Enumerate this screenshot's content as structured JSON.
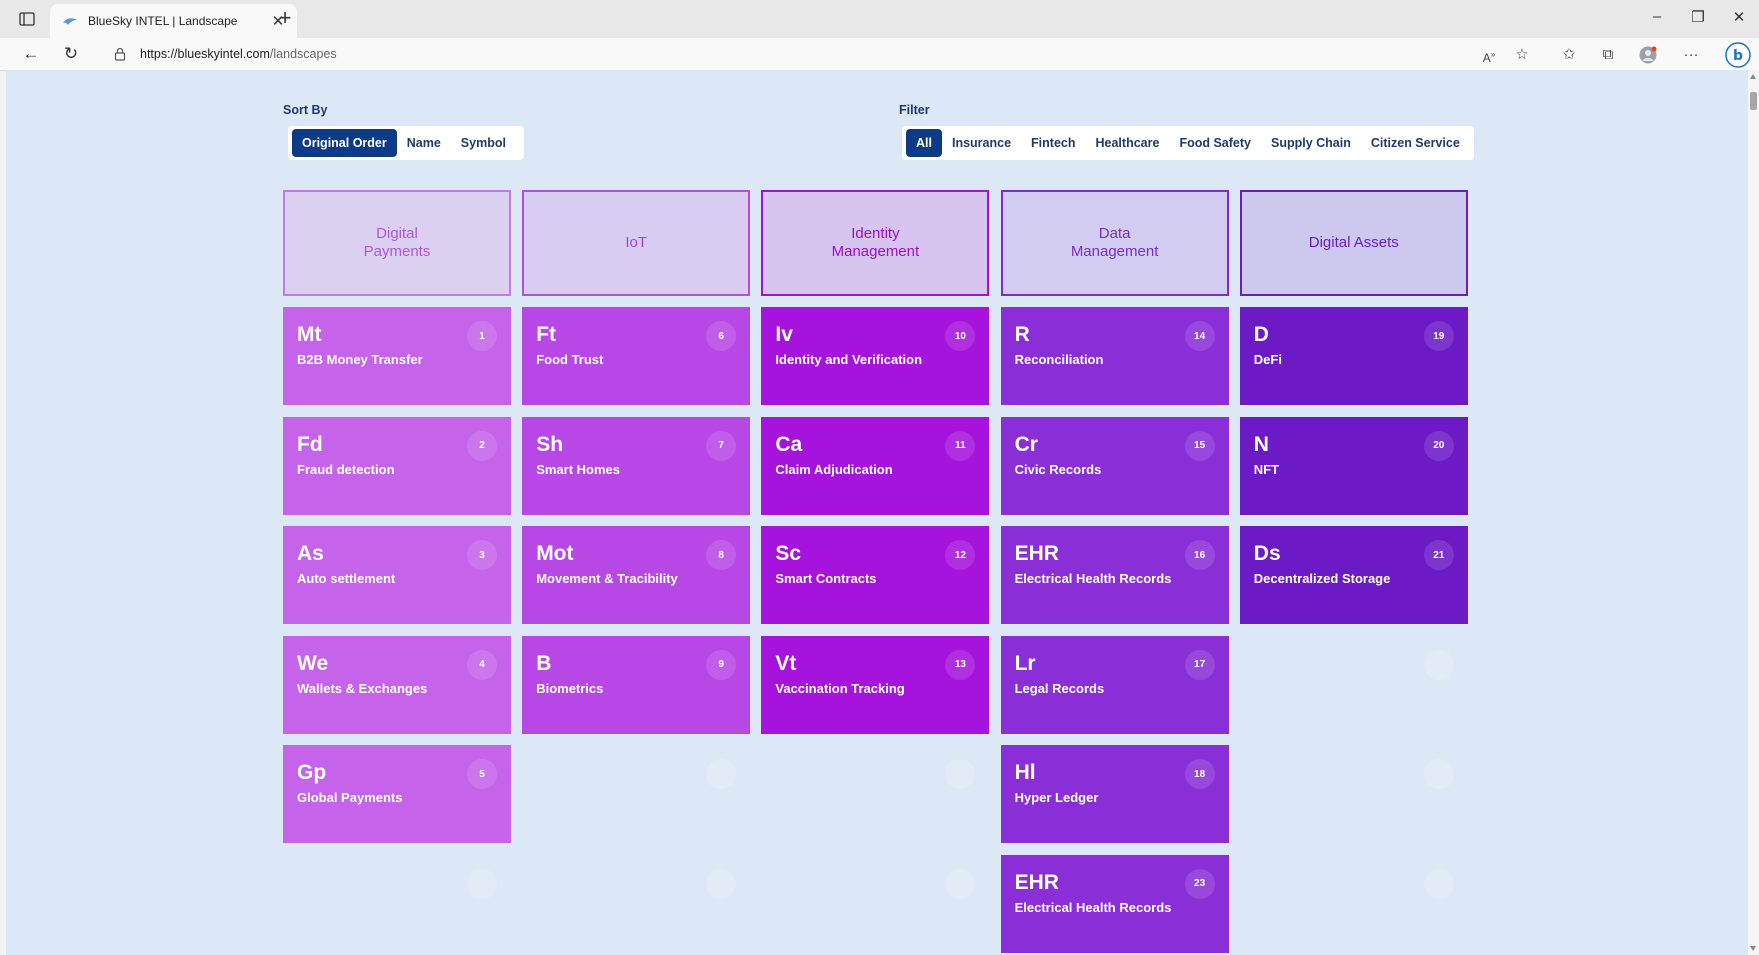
{
  "browser": {
    "tab_title": "BlueSky INTEL | Landscape",
    "url_host": "https://blueskyintel.com",
    "url_path": "/landscapes"
  },
  "sort": {
    "label": "Sort By",
    "options": [
      "Original Order",
      "Name",
      "Symbol"
    ],
    "selected": "Original Order"
  },
  "filter": {
    "label": "Filter",
    "options": [
      "All",
      "Insurance",
      "Fintech",
      "Healthcare",
      "Food Safety",
      "Supply Chain",
      "Citizen Service"
    ],
    "selected": "All"
  },
  "categories": [
    {
      "name": "Digital Payments",
      "border": "#c07ae6",
      "bg": "#dcd0f0",
      "text": "#b055d8"
    },
    {
      "name": "IoT",
      "border": "#b64fe0",
      "bg": "#d8cdf0",
      "text": "#a840dc"
    },
    {
      "name": "Identity Management",
      "border": "#a212d2",
      "bg": "#d6c6ef",
      "text": "#9a10cc"
    },
    {
      "name": "Data Management",
      "border": "#7f2ad0",
      "bg": "#d2cdf0",
      "text": "#7a2cc8"
    },
    {
      "name": "Digital Assets",
      "border": "#6a1cc0",
      "bg": "#cdc9ee",
      "text": "#6a1cc0"
    }
  ],
  "columns": [
    {
      "color": "#c564eb",
      "tiles": [
        {
          "symbol": "Mt",
          "name": "B2B Money Transfer",
          "number": "1"
        },
        {
          "symbol": "Fd",
          "name": "Fraud detection",
          "number": "2"
        },
        {
          "symbol": "As",
          "name": "Auto settlement",
          "number": "3"
        },
        {
          "symbol": "We",
          "name": "Wallets & Exchanges",
          "number": "4"
        },
        {
          "symbol": "Gp",
          "name": "Global Payments",
          "number": "5"
        }
      ]
    },
    {
      "color": "#b848e6",
      "tiles": [
        {
          "symbol": "Ft",
          "name": "Food Trust",
          "number": "6"
        },
        {
          "symbol": "Sh",
          "name": "Smart Homes",
          "number": "7"
        },
        {
          "symbol": "Mot",
          "name": "Movement & Tracibility",
          "number": "8"
        },
        {
          "symbol": "B",
          "name": "Biometrics",
          "number": "9"
        }
      ]
    },
    {
      "color": "#a513dc",
      "tiles": [
        {
          "symbol": "Iv",
          "name": "Identity and Verification",
          "number": "10"
        },
        {
          "symbol": "Ca",
          "name": "Claim Adjudication",
          "number": "11"
        },
        {
          "symbol": "Sc",
          "name": "Smart Contracts",
          "number": "12"
        },
        {
          "symbol": "Vt",
          "name": "Vaccination Tracking",
          "number": "13"
        }
      ]
    },
    {
      "color": "#8a2fd8",
      "tiles": [
        {
          "symbol": "R",
          "name": "Reconciliation",
          "number": "14"
        },
        {
          "symbol": "Cr",
          "name": "Civic Records",
          "number": "15"
        },
        {
          "symbol": "EHR",
          "name": "Electrical Health Records",
          "number": "16"
        },
        {
          "symbol": "Lr",
          "name": "Legal Records",
          "number": "17"
        },
        {
          "symbol": "Hl",
          "name": "Hyper Ledger",
          "number": "18"
        },
        {
          "symbol": "EHR",
          "name": "Electrical Health Records",
          "number": "23"
        }
      ]
    },
    {
      "color": "#6c1ac6",
      "tiles": [
        {
          "symbol": "D",
          "name": "DeFi",
          "number": "19"
        },
        {
          "symbol": "N",
          "name": "NFT",
          "number": "20"
        },
        {
          "symbol": "Ds",
          "name": "Decentralized Storage",
          "number": "21"
        }
      ]
    }
  ]
}
